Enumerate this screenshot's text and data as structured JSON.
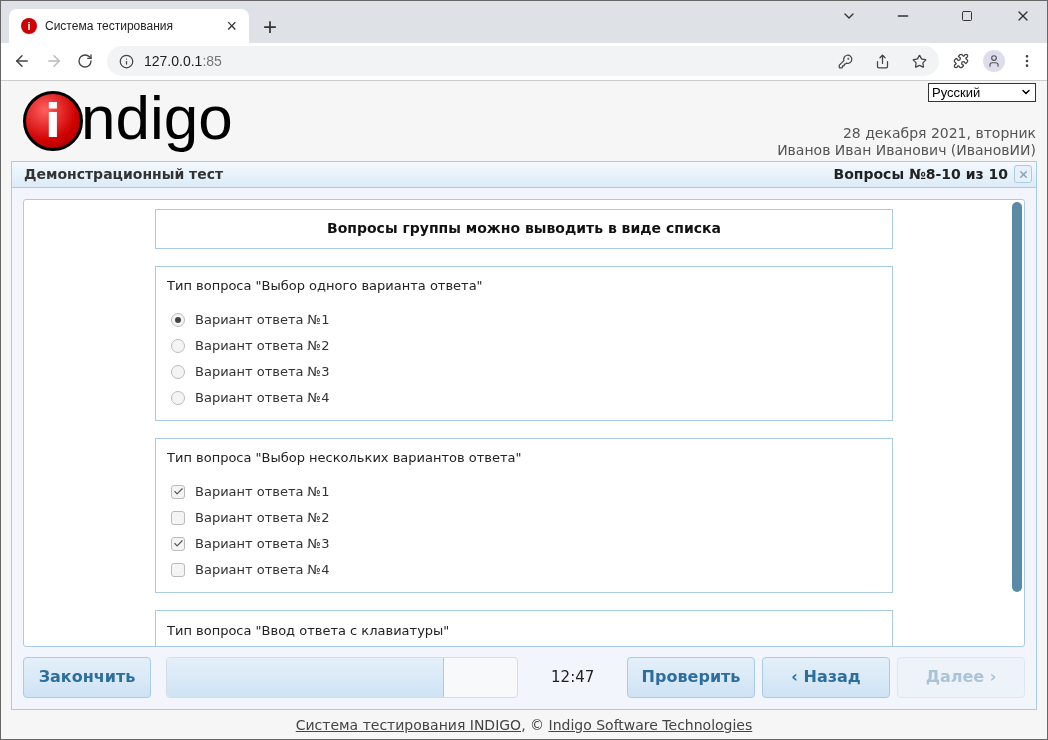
{
  "browser": {
    "favicon": "i",
    "tab_title": "Система тестирования",
    "tab_close": "×",
    "new_tab": "+",
    "url_host": "127.0.0.1",
    "url_port": ":85"
  },
  "header": {
    "logo": {
      "badge": "i",
      "text": "ndigo"
    },
    "language": "Русский",
    "date": "28 декабря 2021, вторник",
    "user": "Иванов Иван Иванович (ИвановИИ)"
  },
  "panel": {
    "title": "Демонстрационный тест",
    "counter": "Вопросы №8-10 из 10",
    "group_title": "Вопросы группы можно выводить в виде списка",
    "questions": [
      {
        "kind": "single",
        "text": "Тип вопроса \"Выбор одного варианта ответа\"",
        "options": [
          {
            "label": "Вариант ответа №1",
            "selected": true
          },
          {
            "label": "Вариант ответа №2",
            "selected": false
          },
          {
            "label": "Вариант ответа №3",
            "selected": false
          },
          {
            "label": "Вариант ответа №4",
            "selected": false
          }
        ]
      },
      {
        "kind": "multiple",
        "text": "Тип вопроса \"Выбор нескольких вариантов ответа\"",
        "options": [
          {
            "label": "Вариант ответа №1",
            "checked": true
          },
          {
            "label": "Вариант ответа №2",
            "checked": false
          },
          {
            "label": "Вариант ответа №3",
            "checked": true
          },
          {
            "label": "Вариант ответа №4",
            "checked": false
          }
        ]
      },
      {
        "kind": "text",
        "text": "Тип вопроса \"Ввод ответа с клавиатуры\""
      }
    ]
  },
  "footer_bar": {
    "finish": "Закончить",
    "progress": {
      "level": 0.79
    },
    "timer": "12:47",
    "check": "Проверить",
    "back": "‹ Назад",
    "next": {
      "label": "Далее ›",
      "disabled": true
    }
  },
  "footer": {
    "link1": "Система тестирования INDIGO",
    "separator": ", © ",
    "link2": "Indigo Software Technologies"
  }
}
